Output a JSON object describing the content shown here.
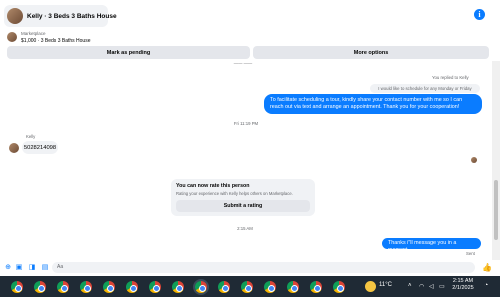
{
  "header": {
    "title": "Kelly · 3 Beds 3 Baths House",
    "info_icon": "info-icon",
    "info_glyph": "i"
  },
  "listing": {
    "category": "Marketplace",
    "price_title": "$1,000 · 3 Beds 3 Baths House",
    "mark_pending_label": "Mark as pending",
    "more_options_label": "More options"
  },
  "conversation": {
    "top_timestamp": "—— ——",
    "replied_note": "You replied to Kelly",
    "quoted_message": "I would like to schedule for any Monday or Friday",
    "outgoing_message_1": "To facilitate scheduling a tour, kindly share your contact number with me so I can reach out via text and arrange an appointment. Thank you for your cooperation!",
    "timestamp_2": "Fri 11:19 PM",
    "sender_name": "Kelly",
    "incoming_message": "5028214098",
    "rating_title": "You can now rate this person",
    "rating_subtitle": "Rating your experience with Kelly helps others on Marketplace.",
    "rating_button": "Submit a rating",
    "timestamp_3": "2:15 AM",
    "outgoing_message_2": "Thanks i\"ll message you in a moment",
    "status": "Sent"
  },
  "composer": {
    "placeholder": "Aa",
    "icons": [
      "plus-icon",
      "image-icon",
      "sticker-icon",
      "gif-icon"
    ],
    "like_icon": "thumbs-up-icon"
  },
  "taskbar": {
    "weather_temp": "11°C",
    "time": "2:15 AM",
    "date": "2/1/2025",
    "app_icons": [
      "chrome-icon"
    ]
  },
  "colors": {
    "accent": "#0a7cff",
    "bubble_incoming": "#f0f2f5",
    "taskbar": "#1f2a35"
  }
}
